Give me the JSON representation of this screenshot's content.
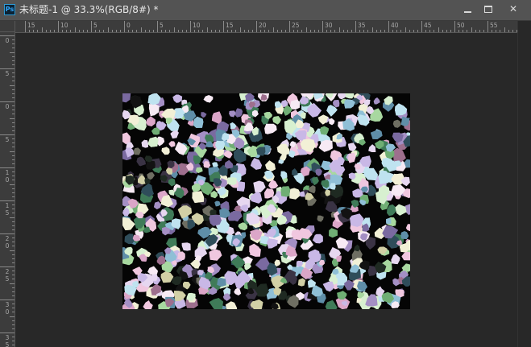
{
  "app": {
    "icon": "photoshop-icon",
    "logo_text": "Ps"
  },
  "document": {
    "title": "未标题-1 @ 33.3%(RGB/8#) *",
    "zoom": "33.3%",
    "color_mode": "RGB/8#",
    "filter_effect": "crystallize",
    "palette": [
      "#f7eaf4",
      "#e6d7f0",
      "#c9b8e6",
      "#a48fc4",
      "#7a6aa0",
      "#d7f0d0",
      "#a8d8a0",
      "#6fae74",
      "#3f7b58",
      "#f0c7df",
      "#dba6c8",
      "#9e6f8e",
      "#bfe3f0",
      "#8fbfd6",
      "#5f8ea8",
      "#2f4d5a",
      "#f2f0d6",
      "#d2d0a6",
      "#6e6e62",
      "#3a3344",
      "#1f2a22",
      "#121212"
    ]
  },
  "window_controls": {
    "minimize": "minimize-icon",
    "maximize": "maximize-icon",
    "close_label": "✕"
  },
  "rulers": {
    "horizontal": [
      "15",
      "10",
      "5",
      "0",
      "5",
      "10",
      "15",
      "20",
      "25",
      "30",
      "35",
      "40",
      "45",
      "50",
      "55"
    ],
    "vertical": [
      "0",
      "5",
      "0",
      "5",
      "1\n0",
      "1\n5",
      "2\n0",
      "2\n5",
      "3\n0",
      "3\n5"
    ]
  }
}
